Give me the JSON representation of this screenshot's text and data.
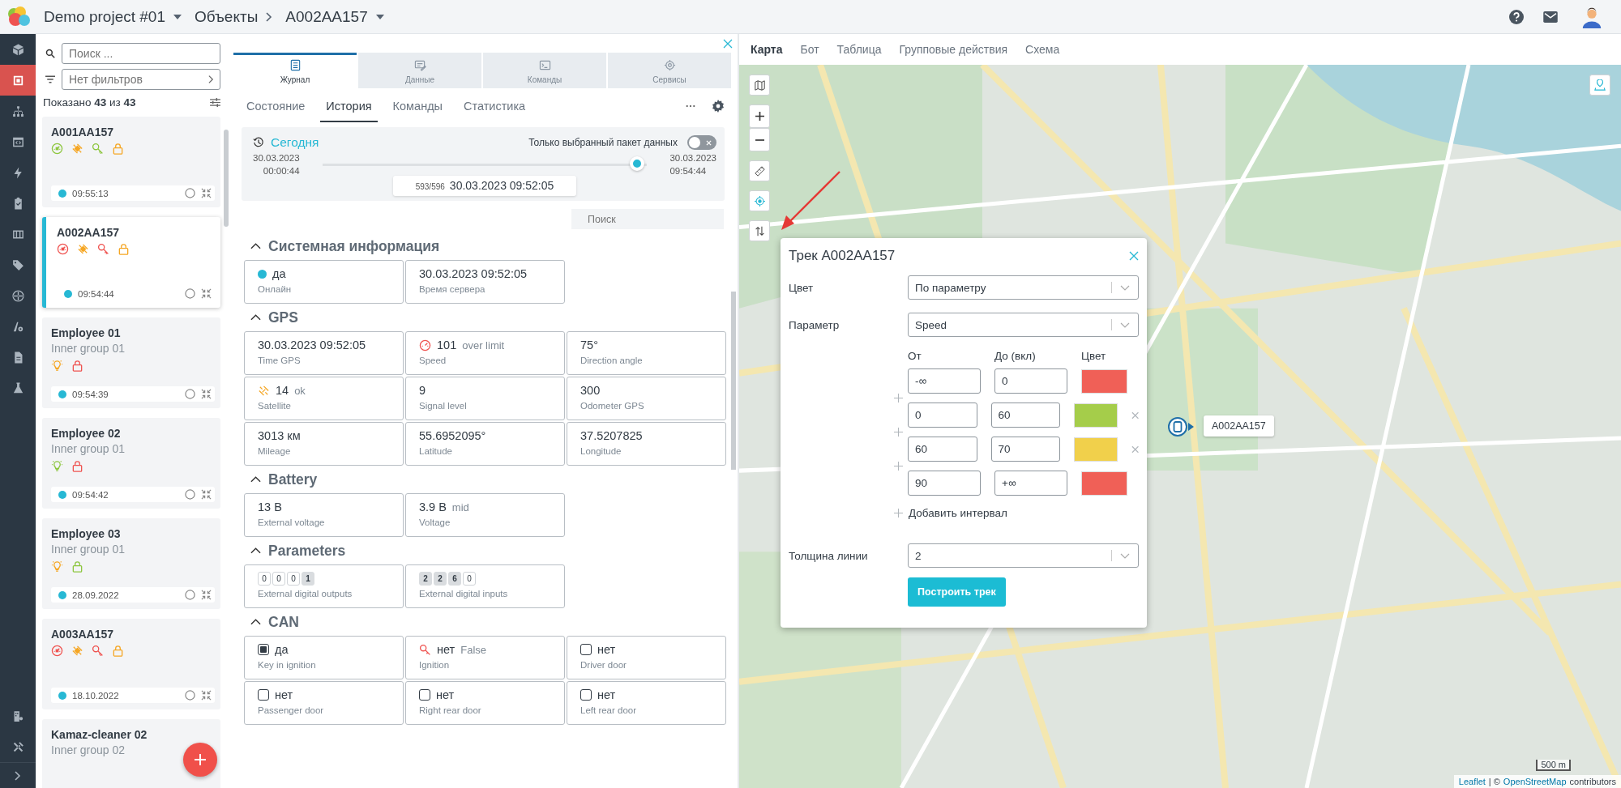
{
  "topbar": {
    "project": "Demo project #01",
    "breadcrumbs": [
      "Объекты",
      "A002AA157"
    ]
  },
  "sidebar": {
    "items": [
      {
        "selected": false
      },
      {
        "selected": true
      },
      {
        "selected": false
      },
      {
        "selected": false
      },
      {
        "selected": false
      },
      {
        "selected": false
      },
      {
        "selected": false
      },
      {
        "selected": false
      },
      {
        "selected": false
      },
      {
        "selected": false
      },
      {
        "selected": false
      },
      {
        "selected": false
      }
    ]
  },
  "objects": {
    "search": {
      "placeholder": "Поиск ..."
    },
    "filter": {
      "placeholder": "Нет фильтров"
    },
    "count": "Показано **43** из **43**",
    "items": [
      {
        "name": "A001AA157",
        "selected": false,
        "time": "09:55:13",
        "status": [
          {
            "kind": "speed",
            "color": "#8dc63f"
          },
          {
            "kind": "gps",
            "color": "#f5a623"
          },
          {
            "kind": "key",
            "color": "#8dc63f"
          },
          {
            "kind": "lock",
            "color": "#f5a623"
          }
        ]
      },
      {
        "name": "A002AA157",
        "selected": true,
        "time": "09:54:44",
        "status": [
          {
            "kind": "speed",
            "color": "#ef5350"
          },
          {
            "kind": "gps",
            "color": "#f5a623"
          },
          {
            "kind": "key",
            "color": "#ef5350"
          },
          {
            "kind": "lock",
            "color": "#f5a623"
          }
        ]
      },
      {
        "name": "Employee 01",
        "group": "Inner group 01",
        "selected": false,
        "time": "09:54:39",
        "status": [
          {
            "kind": "bulb",
            "color": "#f5a623"
          },
          {
            "kind": "lock",
            "color": "#ef5350"
          }
        ]
      },
      {
        "name": "Employee 02",
        "group": "Inner group 01",
        "selected": false,
        "time": "09:54:42",
        "status": [
          {
            "kind": "bulb",
            "color": "#8dc63f"
          },
          {
            "kind": "lock",
            "color": "#ef5350"
          }
        ]
      },
      {
        "name": "Employee 03",
        "group": "Inner group 01",
        "selected": false,
        "time": "28.09.2022",
        "status": [
          {
            "kind": "bulb",
            "color": "#f5a623"
          },
          {
            "kind": "lock",
            "color": "#8dc63f"
          }
        ]
      },
      {
        "name": "A003AA157",
        "selected": false,
        "time": "18.10.2022",
        "status": [
          {
            "kind": "speed",
            "color": "#ef5350"
          },
          {
            "kind": "gps",
            "color": "#f5a623"
          },
          {
            "kind": "key",
            "color": "#ef5350"
          },
          {
            "kind": "lock",
            "color": "#f5a623"
          }
        ]
      },
      {
        "name": "Kamaz-cleaner 02",
        "group": "Inner group 02",
        "selected": false
      }
    ]
  },
  "panel": {
    "tabs": [
      {
        "label": "Журнал",
        "selected": true
      },
      {
        "label": "Данные",
        "selected": false
      },
      {
        "label": "Команды",
        "selected": false
      },
      {
        "label": "Сервисы",
        "selected": false
      }
    ],
    "subtabs": [
      {
        "label": "Состояние",
        "selected": false
      },
      {
        "label": "История",
        "selected": true
      },
      {
        "label": "Команды",
        "selected": false
      },
      {
        "label": "Статистика",
        "selected": false
      }
    ],
    "history": {
      "period": "Сегодня",
      "toggle": {
        "label": "Только выбранный пакет данных",
        "on": false
      },
      "start_date": "30.03.2023",
      "start_time": "00:00:44",
      "end_date": "30.03.2023",
      "end_time": "09:54:44",
      "level": 0.97,
      "counter": "593/596",
      "timestamp": "30.03.2023 09:52:05"
    },
    "search": {
      "placeholder": "Поиск"
    },
    "sections": [
      {
        "title": "Системная информация",
        "expanded": true,
        "cells": [
          {
            "kind": "online",
            "value": "да",
            "label": "Онлайн"
          },
          {
            "kind": "text",
            "value": "30.03.2023 09:52:05",
            "label": "Время сервера"
          }
        ]
      },
      {
        "title": "GPS",
        "expanded": true,
        "cells": [
          {
            "kind": "text",
            "value": "30.03.2023 09:52:05",
            "label": "Time GPS"
          },
          {
            "kind": "speed",
            "value": "101",
            "note": "over limit",
            "label": "Speed"
          },
          {
            "kind": "text",
            "value": "75°",
            "label": "Direction angle"
          },
          {
            "kind": "satellite",
            "value": "14",
            "note": "ok",
            "label": "Satellite"
          },
          {
            "kind": "text",
            "value": "9",
            "label": "Signal level"
          },
          {
            "kind": "text",
            "value": "300",
            "label": "Odometer GPS"
          },
          {
            "kind": "text",
            "value": "3013 км",
            "label": "Mileage"
          },
          {
            "kind": "text",
            "value": "55.6952095°",
            "label": "Latitude"
          },
          {
            "kind": "text",
            "value": "37.5207825",
            "label": "Longitude"
          }
        ]
      },
      {
        "title": "Battery",
        "expanded": true,
        "cells": [
          {
            "kind": "text",
            "value": "13 В",
            "label": "External voltage"
          },
          {
            "kind": "text",
            "value": "3.9 В",
            "note": "mid",
            "label": "Voltage"
          }
        ]
      },
      {
        "title": "Parameters",
        "expanded": true,
        "cells": [
          {
            "kind": "digits",
            "label": "External digital outputs",
            "digits": [
              {
                "value": "0",
                "on": false
              },
              {
                "value": "0",
                "on": false
              },
              {
                "value": "0",
                "on": false
              },
              {
                "value": "1",
                "on": true
              }
            ]
          },
          {
            "kind": "digits",
            "label": "External digital inputs",
            "digits": [
              {
                "value": "2",
                "on": true
              },
              {
                "value": "2",
                "on": true
              },
              {
                "value": "6",
                "on": true
              },
              {
                "value": "0",
                "on": false
              }
            ]
          }
        ]
      },
      {
        "title": "CAN",
        "expanded": true,
        "cells": [
          {
            "kind": "checkbox",
            "checked": true,
            "value": "да",
            "label": "Key in ignition"
          },
          {
            "kind": "ignition",
            "value": "нет",
            "note": "False",
            "label": "Ignition"
          },
          {
            "kind": "checkbox",
            "checked": false,
            "value": "нет",
            "label": "Driver door"
          },
          {
            "kind": "checkbox",
            "checked": false,
            "value": "нет",
            "label": "Passenger door"
          },
          {
            "kind": "checkbox",
            "checked": false,
            "value": "нет",
            "label": "Right rear door"
          },
          {
            "kind": "checkbox",
            "checked": false,
            "value": "нет",
            "label": "Left rear door"
          }
        ]
      }
    ]
  },
  "map": {
    "tabs": [
      {
        "label": "Карта",
        "selected": true
      },
      {
        "label": "Бот",
        "selected": false
      },
      {
        "label": "Таблица",
        "selected": false
      },
      {
        "label": "Групповые действия",
        "selected": false
      },
      {
        "label": "Схема",
        "selected": false
      }
    ],
    "marker": {
      "label": "A002AA157"
    },
    "scale": "500 m",
    "attribution": {
      "link": "Leaflet",
      "text": "| ©",
      "osm_link": "OpenStreetMap",
      "suffix": "contributors"
    }
  },
  "track_dialog": {
    "title": "Трек A002AA157",
    "fields": [
      {
        "label": "Цвет",
        "value": "По параметру"
      },
      {
        "label": "Параметр",
        "value": "Speed"
      }
    ],
    "intervals": {
      "headers": [
        "От",
        "До (вкл)",
        "Цвет"
      ],
      "rows": [
        {
          "from": "-∞",
          "to": "0",
          "color": "#f06057",
          "removable": false
        },
        {
          "from": "0",
          "to": "60",
          "color": "#a5cd4a",
          "removable": true
        },
        {
          "from": "60",
          "to": "70",
          "color": "#f1d04b",
          "removable": true
        },
        {
          "from": "90",
          "to": "+∞",
          "color": "#f06057",
          "removable": false
        }
      ]
    },
    "add_label": "Добавить интервал",
    "thickness": {
      "label": "Толщина линии",
      "value": "2"
    },
    "button": "Построить трек"
  }
}
